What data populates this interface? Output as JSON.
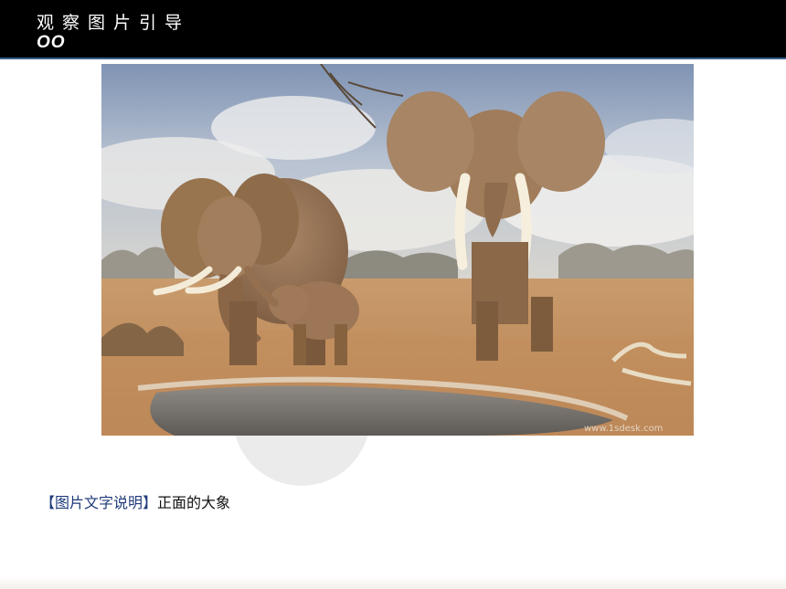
{
  "header": {
    "title": "观察图片引导",
    "subtitle": "OO"
  },
  "photo": {
    "subject": "elephants-at-waterhole",
    "watermark": "www.1sdesk.com"
  },
  "caption": {
    "label": "【图片文字说明】",
    "text": "正面的大象"
  },
  "colors": {
    "header_bg": "#000000",
    "header_border": "#3a5f8a",
    "caption_label": "#1f3a7a"
  }
}
